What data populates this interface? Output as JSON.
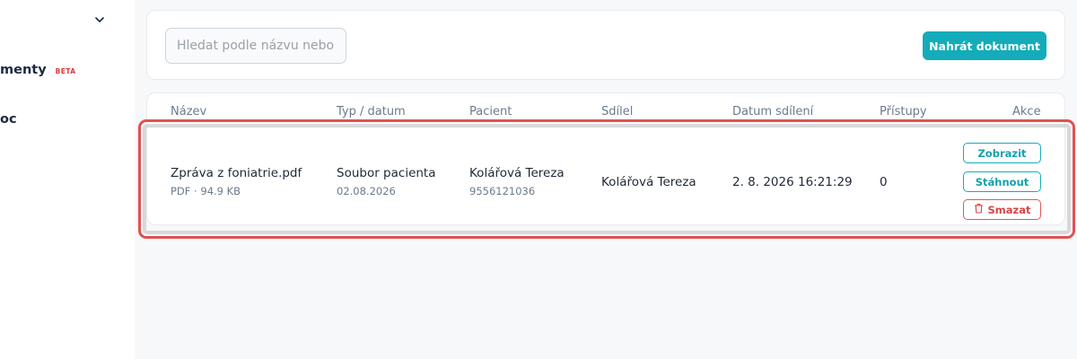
{
  "sidebar": {
    "items": [
      {
        "label": "menty",
        "badge": "BETA"
      },
      {
        "label": "oc"
      }
    ]
  },
  "toolbar": {
    "search_placeholder": "Hledat podle názvu nebo",
    "upload_label": "Nahrát dokument"
  },
  "table": {
    "columns": [
      "Název",
      "Typ / datum",
      "Pacient",
      "Sdílel",
      "Datum sdílení",
      "Přístupy",
      "Akce"
    ],
    "rows": [
      {
        "name": "Zpráva z foniatrie.pdf",
        "file_meta": "PDF · 94.9 KB",
        "type": "Soubor pacienta",
        "type_date": "02.08.2026",
        "patient": "Kolářová Tereza",
        "patient_id": "9556121036",
        "shared_by": "Kolářová Tereza",
        "shared_at": "2. 8. 2026 16:21:29",
        "access_count": "0",
        "actions": {
          "view": "Zobrazit",
          "download": "Stáhnout",
          "delete": "Smazat"
        }
      }
    ]
  },
  "colors": {
    "accent": "#14acba",
    "danger": "#d94545",
    "highlight": "#e05252"
  },
  "icons": {
    "sidebar_toggle": "chevron-down-icon",
    "delete": "trash-icon"
  }
}
